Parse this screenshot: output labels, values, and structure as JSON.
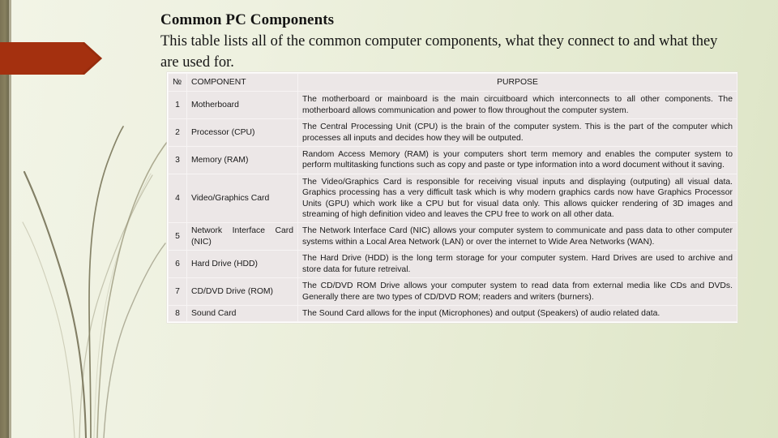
{
  "slide": {
    "title": "Common PC Components",
    "subtitle": "This table lists all of the common computer components, what they connect to and what they are used for.",
    "accent_color": "#a4300f",
    "band_color": "#7b7355",
    "background_from": "#f2f4e6",
    "background_to": "#dde5c6",
    "table_cell_color": "#ece7e7"
  },
  "table": {
    "headers": {
      "no": "№",
      "component": "COMPONENT",
      "purpose": "PURPOSE"
    },
    "rows": [
      {
        "no": "1",
        "component": "Motherboard",
        "justified": false,
        "purpose": "The motherboard or mainboard is the main circuitboard which interconnects to all other components. The motherboard allows communication and power to flow throughout the computer system."
      },
      {
        "no": "2",
        "component": "Processor (CPU)",
        "justified": false,
        "purpose": "The Central Processing Unit (CPU) is the brain of the computer system. This is the part of the computer which processes all inputs and decides how they will be outputed."
      },
      {
        "no": "3",
        "component": "Memory (RAM)",
        "justified": false,
        "purpose": "Random Access Memory (RAM) is your computers short term memory and enables the computer system to perform multitasking functions such as copy and paste or type information into a word document without it saving."
      },
      {
        "no": "4",
        "component": "Video/Graphics Card",
        "justified": false,
        "purpose": "The Video/Graphics Card is responsible for receiving visual inputs and displaying (outputing) all visual data. Graphics processing has a very difficult task which is why modern graphics cards now have Graphics Processor Units (GPU) which work like a CPU but for visual data only. This allows quicker rendering of 3D images and streaming of high definition video and leaves the CPU free to work on all other data."
      },
      {
        "no": "5",
        "component": "Network Interface Card (NIC)",
        "justified": true,
        "purpose": "The Network Interface Card (NIC) allows your computer system to communicate and pass data to other computer systems within a Local Area Network (LAN) or over the internet to Wide Area Networks (WAN)."
      },
      {
        "no": "6",
        "component": "Hard Drive (HDD)",
        "justified": false,
        "purpose": "The Hard Drive (HDD) is the long term storage for your computer system. Hard Drives are used to archive and store data for future retreival."
      },
      {
        "no": "7",
        "component": "CD/DVD Drive (ROM)",
        "justified": false,
        "purpose": "The CD/DVD ROM Drive allows your computer system to read data from external media like CDs and DVDs. Generally there are two types of CD/DVD ROM; readers and writers (burners)."
      },
      {
        "no": "8",
        "component": "Sound Card",
        "justified": false,
        "purpose": "The Sound Card allows for the input (Microphones) and output (Speakers) of audio related data."
      }
    ]
  }
}
